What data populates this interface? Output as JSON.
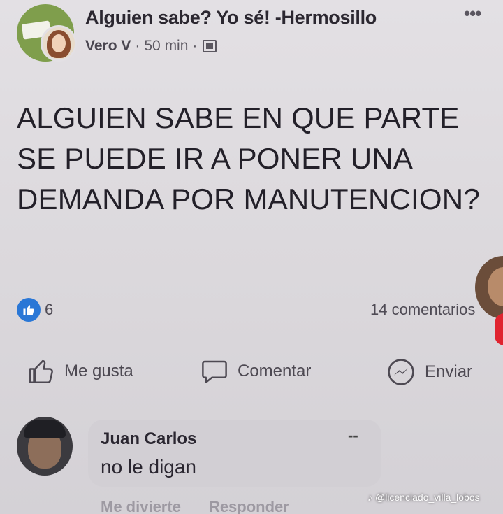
{
  "header": {
    "group_name": "Alguien sabe? Yo sé! -Hermosillo",
    "author": "Vero V",
    "time": "50 min",
    "more_label": "•••"
  },
  "post": {
    "text": "ALGUIEN SABE EN QUE PARTE SE PUEDE IR A PONER UNA DEMANDA POR MANUTENCION?"
  },
  "stats": {
    "likes": "6",
    "comments": "14 comentarios"
  },
  "actions": {
    "like_label": "Me gusta",
    "comment_label": "Comentar",
    "send_label": "Enviar"
  },
  "comment": {
    "name": "Juan Carlos",
    "text": "no le digan",
    "dash": "--",
    "reaction_label": "Me divierte",
    "reply_label": "Responder"
  },
  "watermark": {
    "handle": "@licenciado_villa_lobos"
  },
  "colors": {
    "like_badge": "#2a77d6",
    "background": "#dcd9dd"
  },
  "icons": {
    "like": "thumbs-up-icon",
    "comment": "speech-bubble-icon",
    "send": "messenger-icon",
    "privacy": "group-privacy-icon",
    "more": "more-dots-icon"
  }
}
